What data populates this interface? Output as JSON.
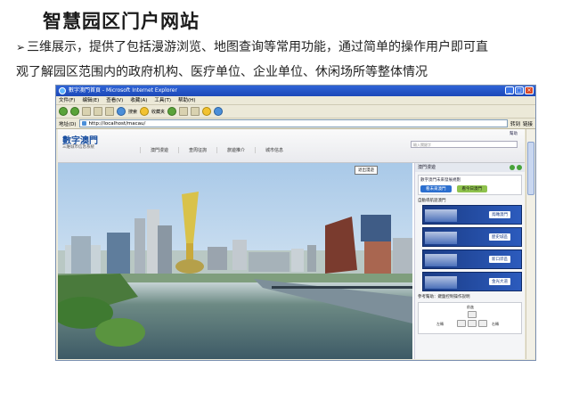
{
  "slide": {
    "title": "智慧园区门户网站",
    "bullet_line1": "三维展示，提供了包括漫游浏览、地图查询等常用功能，通过简单的操作用户即可直",
    "bullet_line2": "观了解园区范围内的政府机构、医疗单位、企业单位、休闲场所等整体情况"
  },
  "browser": {
    "window_title": "數字澳門首頁 - Microsoft Internet Explorer",
    "menu": [
      "文件(F)",
      "编辑(E)",
      "查看(V)",
      "收藏(A)",
      "工具(T)",
      "帮助(H)"
    ],
    "toolbar": {
      "search": "搜索",
      "favorites": "收藏夹"
    },
    "address_label": "地址(D)",
    "address_value": "http://localhost/macau/",
    "go_label": "转到",
    "links_label": "链接"
  },
  "site": {
    "logo": "數字澳門",
    "subtitle": "三維城市信息系統",
    "nav": [
      "澳門漫遊",
      "查周征詢",
      "旅遊推介",
      "城市信息"
    ],
    "search_placeholder": "輸入關鍵字",
    "top_link": "幫助",
    "hero_badge": "退出漫遊"
  },
  "side": {
    "header": "澳門漫遊",
    "box_caption": "數字澳門未來發展規劃",
    "btn_future": "看未來澳門",
    "btn_today": "看今日澳門",
    "section_title": "自動導航遊澳門",
    "tiles": [
      "鳥瞰澳門",
      "歷史城區",
      "新口岸區",
      "金光大道"
    ],
    "help_text": "參考幫助：鍵盤控制操作說明",
    "ctrl_up": "前進",
    "ctrl_left": "左轉",
    "ctrl_right": "右轉"
  }
}
